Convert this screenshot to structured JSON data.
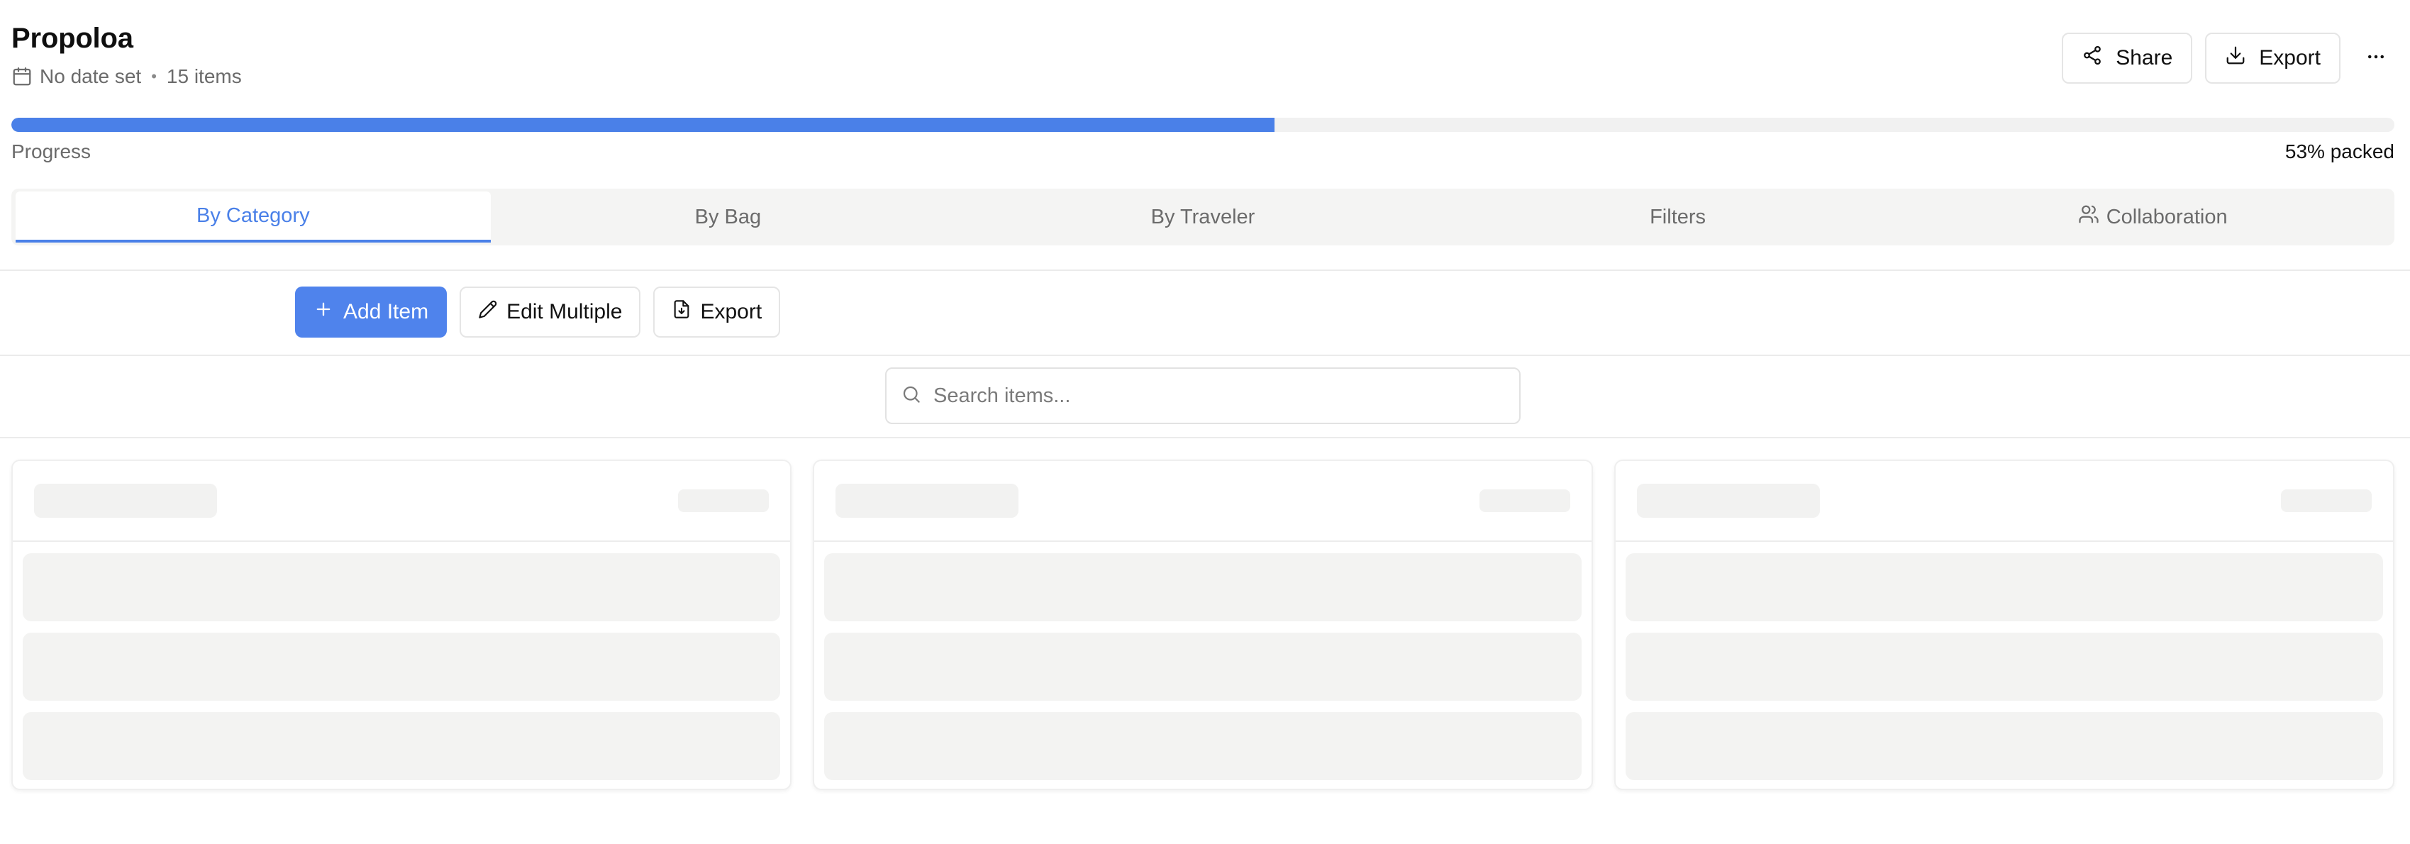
{
  "header": {
    "title": "Propoloa",
    "date_text": "No date set",
    "separator": "•",
    "items_text": "15 items",
    "share_label": "Share",
    "export_label": "Export",
    "more_icon": "more-horizontal-icon"
  },
  "progress": {
    "label": "Progress",
    "value_text": "53% packed",
    "fraction": 0.53,
    "color": "#4a80e8"
  },
  "tabs": [
    {
      "label": "By Category",
      "active": true
    },
    {
      "label": "By Bag",
      "active": false
    },
    {
      "label": "By Traveler",
      "active": false
    },
    {
      "label": "Filters",
      "active": false
    },
    {
      "label": "Collaboration",
      "active": false,
      "icon": "users-icon"
    }
  ],
  "toolbar": {
    "add_label": "Add Item",
    "edit_label": "Edit Multiple",
    "export_label": "Export"
  },
  "search": {
    "placeholder": "Search items...",
    "value": ""
  },
  "colors": {
    "accent": "#4a80e8",
    "primary_button": "#4f83ec"
  }
}
